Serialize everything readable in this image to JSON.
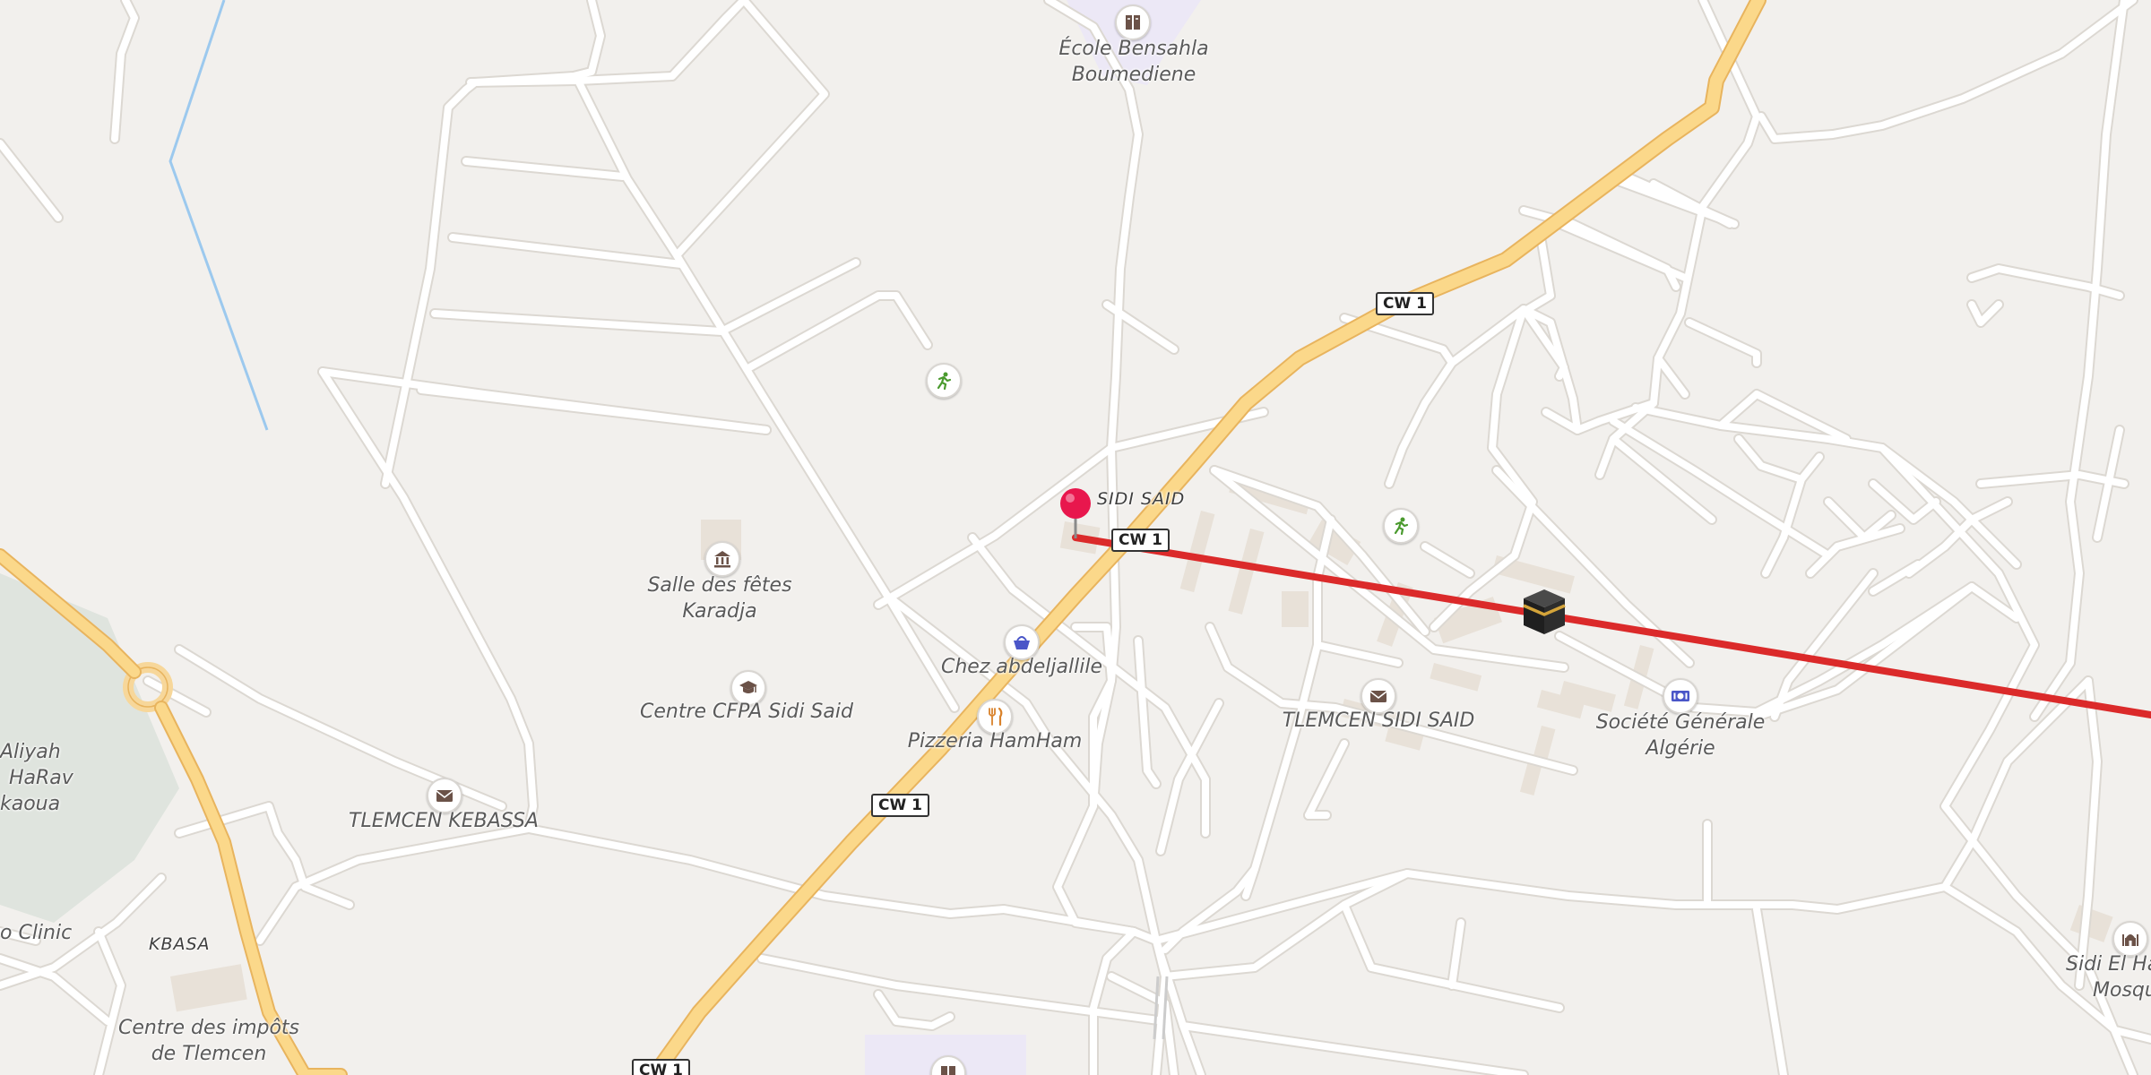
{
  "map": {
    "colors": {
      "background": "#f2f0ed",
      "road": "#ffffff",
      "road_casing": "#dcd8d2",
      "primary_road": "#fbd88a",
      "primary_casing": "#e8b45e",
      "route": "#db2a2a",
      "water": "#9cc9ee",
      "park": "#dfe4de",
      "school_area": "#ece8f6",
      "building": "#e8e1d8",
      "pin": "#e8174d"
    },
    "road_shields": [
      "CW 1",
      "CW 1",
      "CW 1",
      "CW 1"
    ],
    "place_labels": {
      "sidi_said": "SIDI SAID",
      "kbasa": "KBASA"
    },
    "poi_labels": {
      "ecole": [
        "École Bensahla",
        "Boumediene"
      ],
      "salle": [
        "Salle des fêtes",
        "Karadja"
      ],
      "cfpa": "Centre CFPA Sidi Said",
      "chez": "Chez abdeljallile",
      "pizzeria": "Pizzeria HamHam",
      "kebassa": "TLEMCEN KEBASSA",
      "sidi_said_post": "TLEMCEN SIDI SAID",
      "societe": [
        "Société Générale",
        "Algérie"
      ],
      "aliyah": [
        "Aliyah",
        "HaRav",
        "kaoua"
      ],
      "clinic": "o Clinic",
      "impots": [
        "Centre des impôts",
        "de Tlemcen"
      ],
      "sidi_el_ha": [
        "Sidi El Ha",
        "Mosqu"
      ]
    },
    "icons": {
      "school": "school-icon",
      "sport": "sports-icon",
      "museum": "museum-icon",
      "graduation": "graduation-cap-icon",
      "shop": "shopping-basket-icon",
      "restaurant": "restaurant-icon",
      "post": "post-office-icon",
      "bank": "bank-icon",
      "mosque": "mosque-icon",
      "destination": "kaaba-icon",
      "pin": "location-pin-icon"
    }
  }
}
